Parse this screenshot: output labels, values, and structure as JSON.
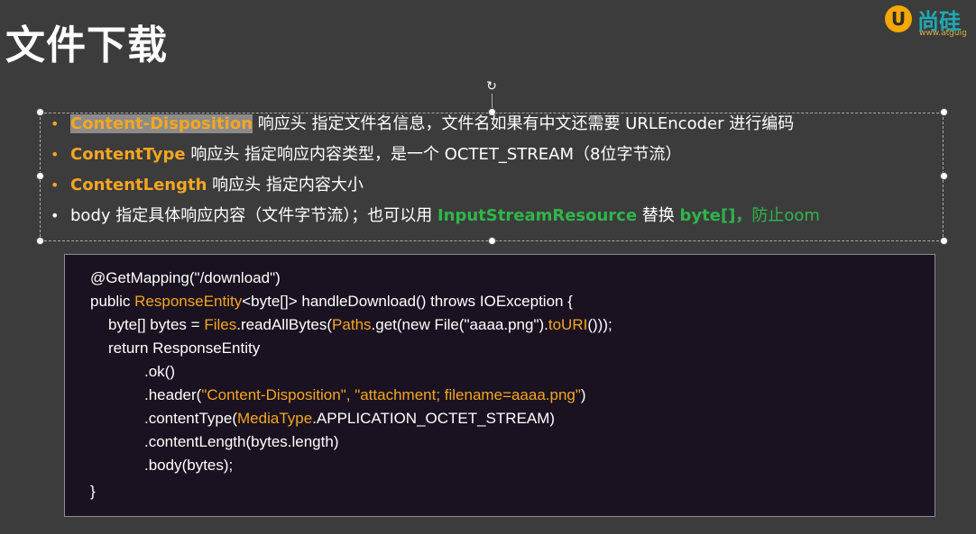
{
  "slide": {
    "title": "文件下载"
  },
  "logo": {
    "mark": "U",
    "text": "尚硅",
    "url": "www.atguig"
  },
  "bullets": [
    {
      "k": "Content-Disposition",
      "t": " 响应头 指定文件名信息，文件名如果有中文还需要 URLEncoder 进行编码"
    },
    {
      "k": "ContentType",
      "t": " 响应头 指定响应内容类型，是一个 OCTET_STREAM（8位字节流）"
    },
    {
      "k": "ContentLength",
      "t": " 响应头 指定内容大小"
    },
    {
      "a": "body 指定具体响应内容（文件字节流）；也可以用 ",
      "g1": "InputStreamResource",
      "b": " 替换 ",
      "g2": "byte[]，",
      "g3": "防止oom"
    }
  ],
  "code": {
    "l1": "@GetMapping(\"/download\")",
    "l2a": "public ",
    "l2b": "ResponseEntity",
    "l2c": "<byte[]> handleDownload() throws IOException {",
    "l3a": "byte[] bytes = ",
    "l3b": "Files",
    "l3c": ".readAllBytes(",
    "l3d": "Paths",
    "l3e": ".get(new File(\"aaaa.png\").",
    "l3f": "toURI",
    "l3g": "()));",
    "l4": "return ResponseEntity",
    "l5": ".ok()",
    "l6a": ".header(",
    "l6b": "\"Content-Disposition\", \"attachment; filename=aaaa.png\"",
    "l6c": ")",
    "l7a": ".contentType(",
    "l7b": "MediaType",
    "l7c": ".APPLICATION_OCTET_STREAM)",
    "l8": ".contentLength(bytes.length)",
    "l9": ".body(bytes);",
    "l10": "}"
  },
  "colors": {
    "background": "#3c3c3c",
    "accent_orange": "#f5a623",
    "accent_green": "#2fb64a",
    "code_bg": "#1a1220"
  }
}
